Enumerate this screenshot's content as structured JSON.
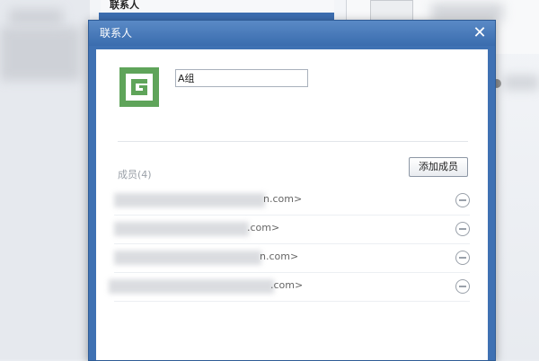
{
  "background": {
    "window_label": "联系人"
  },
  "dialog": {
    "title": "联系人",
    "close_glyph": "✕",
    "group_name_value": "A组",
    "members_label": "成员(4)",
    "add_member_label": "添加成员",
    "members": [
      {
        "email_suffix": "n.com>"
      },
      {
        "email_suffix": ".com>"
      },
      {
        "email_suffix": "n.com>"
      },
      {
        "email_suffix": ".com>"
      }
    ],
    "icons": {
      "group": "green-g-logo-icon",
      "remove": "minus-circle-icon",
      "close": "close-icon"
    },
    "colors": {
      "titlebar": "#3f71b3",
      "logo_green": "#5fa45a"
    }
  }
}
